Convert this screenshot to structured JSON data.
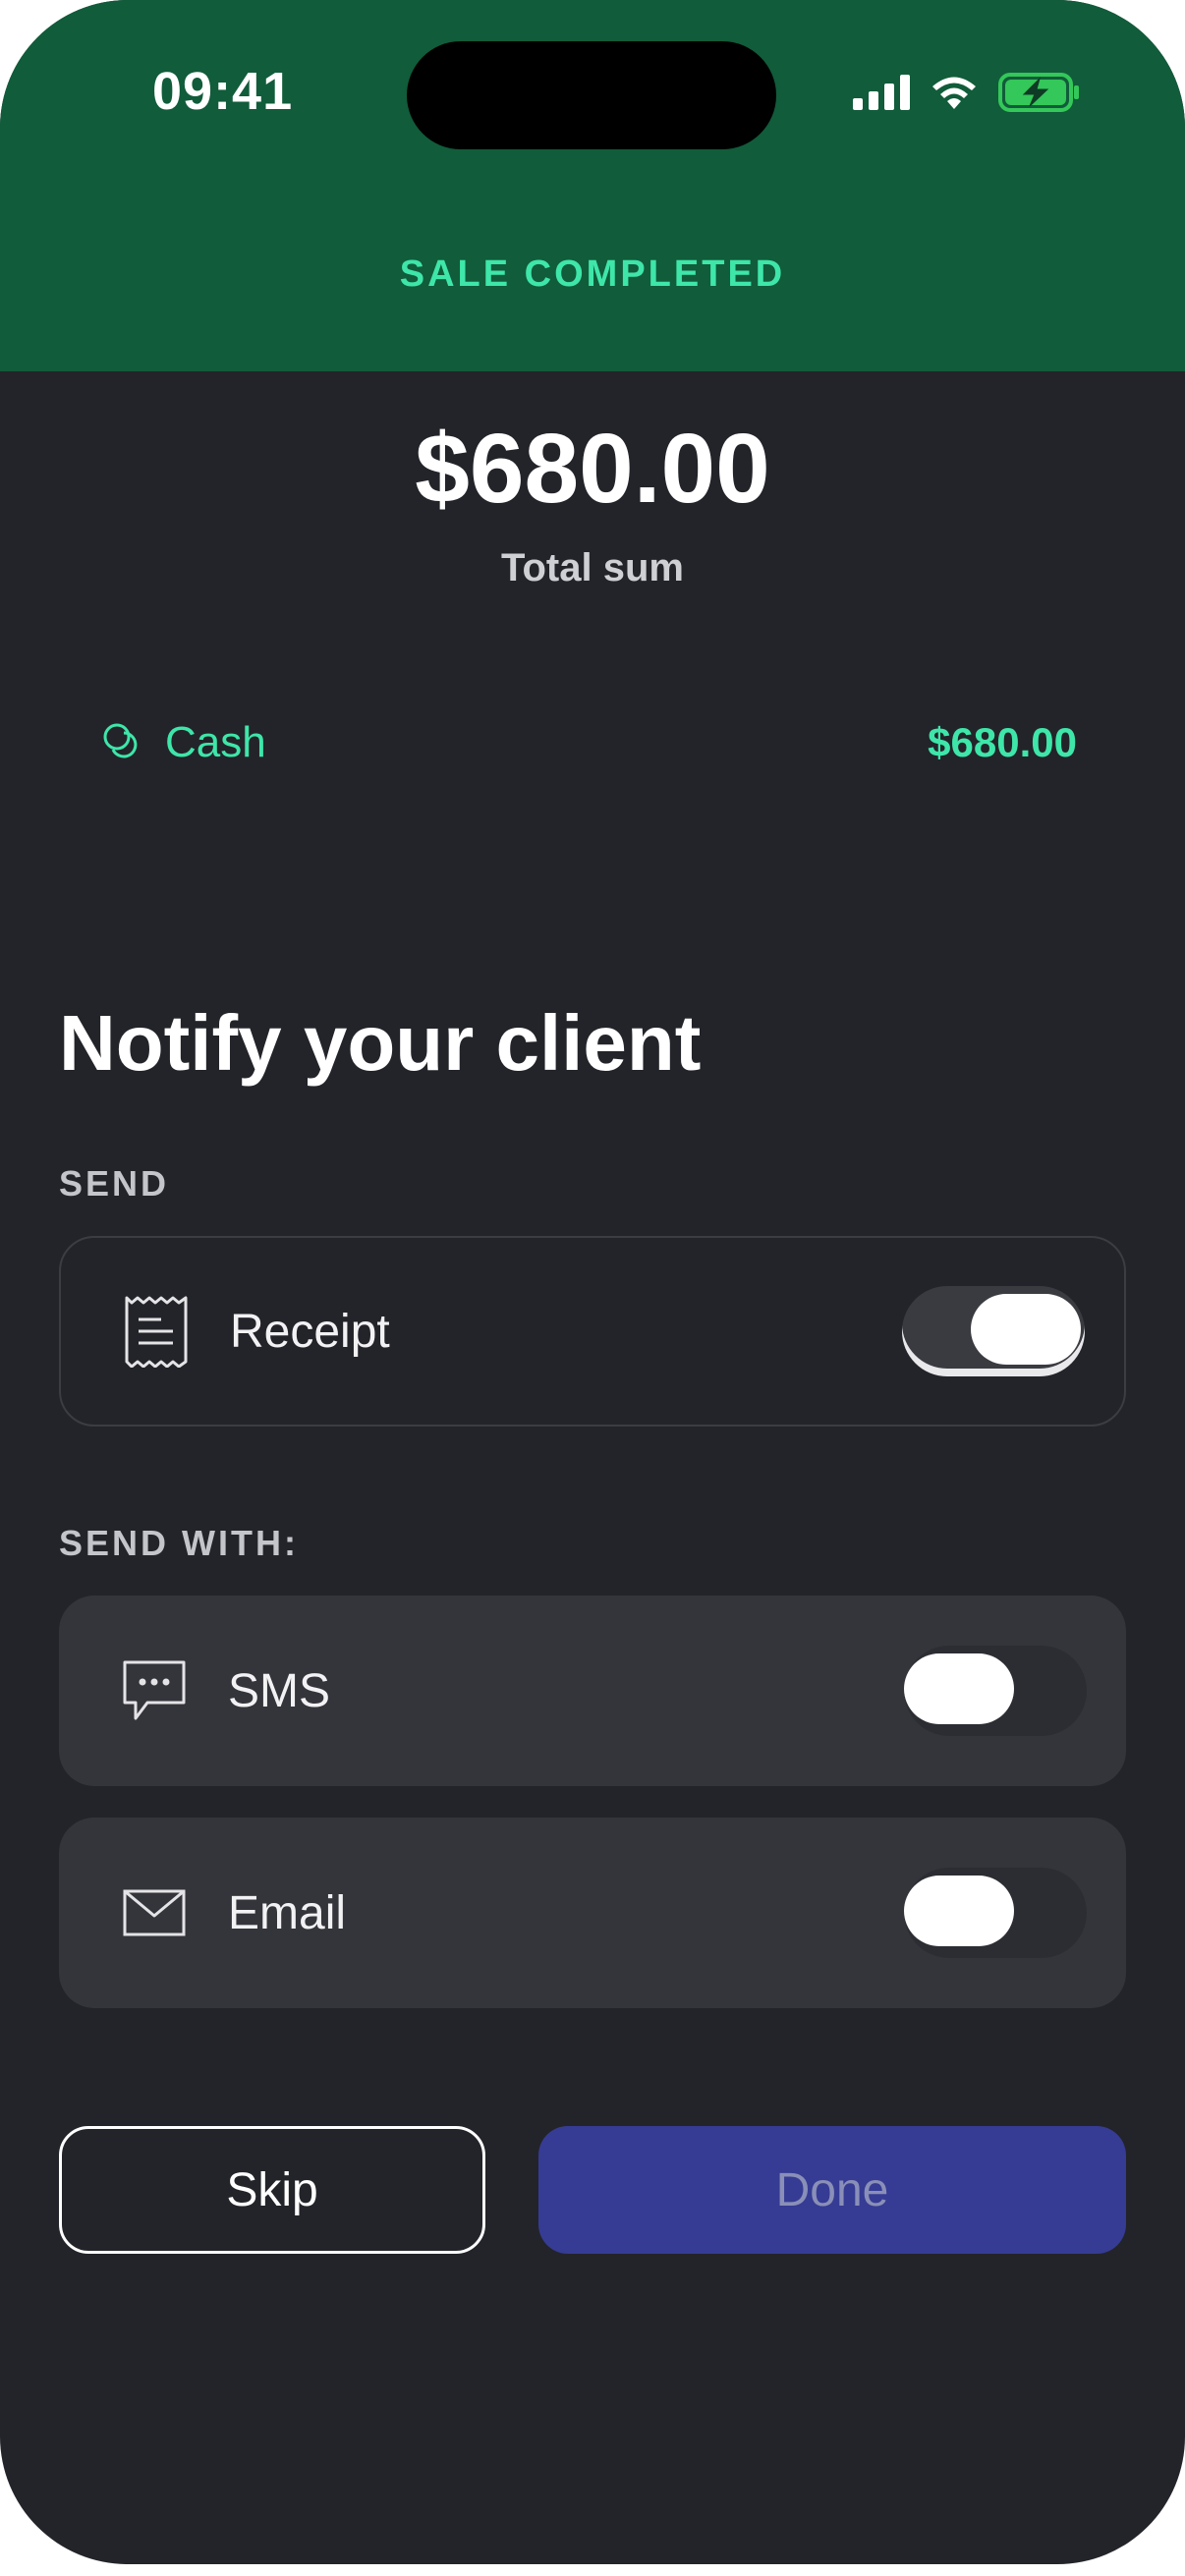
{
  "status_bar": {
    "time": "09:41",
    "icons": [
      "cellular-signal-icon",
      "wifi-icon",
      "battery-charging-icon"
    ],
    "battery_color": "#34c759"
  },
  "header": {
    "title": "SALE COMPLETED",
    "background_color": "#115c3a",
    "accent_color": "#3ee6a9"
  },
  "summary": {
    "total_amount": "$680.00",
    "total_label": "Total sum"
  },
  "payment": {
    "icon": "coins-icon",
    "method": "Cash",
    "amount": "$680.00"
  },
  "notify": {
    "title": "Notify your client",
    "send_label": "SEND",
    "receipt": {
      "icon": "receipt-icon",
      "label": "Receipt",
      "enabled": true
    },
    "send_with_label": "SEND WITH:",
    "sms": {
      "icon": "chat-bubble-icon",
      "label": "SMS",
      "enabled": false
    },
    "email": {
      "icon": "envelope-icon",
      "label": "Email",
      "enabled": false
    }
  },
  "actions": {
    "skip_label": "Skip",
    "done_label": "Done",
    "done_color": "#363c93"
  }
}
